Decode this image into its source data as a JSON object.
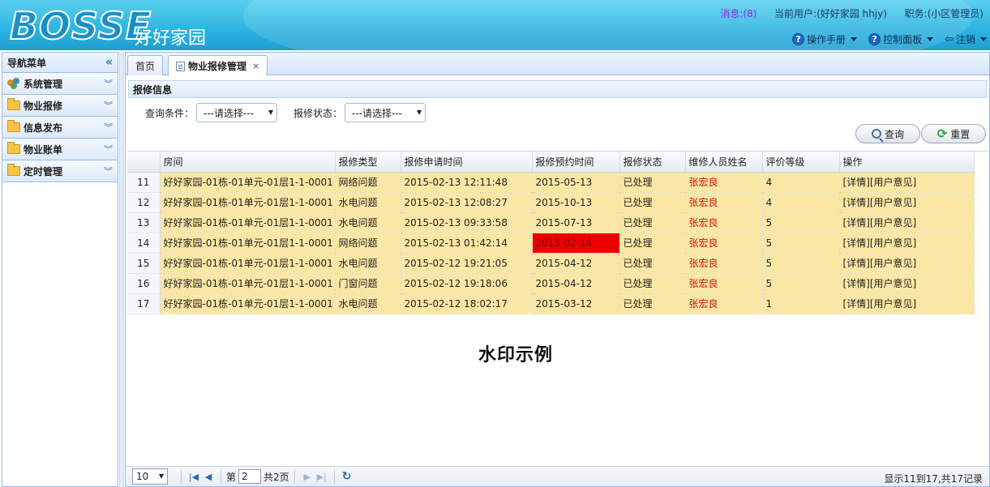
{
  "header": {
    "logo": "BOSSE",
    "site_name": "好好家园",
    "messages_label": "消息:",
    "messages_count": "(8)",
    "current_user": "当前用户:(好好家园 hhjy)",
    "position": "职务:(小区管理员)",
    "menu": {
      "manual": "操作手册",
      "control_panel": "控制面板",
      "logout": "注销"
    }
  },
  "sidebar": {
    "title": "导航菜单",
    "items": [
      "系统管理",
      "物业报修",
      "信息发布",
      "物业账单",
      "定时管理"
    ]
  },
  "tabs": {
    "home": "首页",
    "repair": "物业报修管理"
  },
  "panel": {
    "title": "报修信息",
    "filter_condition_label": "查询条件：",
    "filter_condition_value": "---请选择---",
    "filter_status_label": "报修状态：",
    "filter_status_value": "---请选择---",
    "search_button": "查询",
    "reset_button": "重置"
  },
  "table": {
    "columns": [
      "房间",
      "报修类型",
      "报修申请时间",
      "报修预约时间",
      "报修状态",
      "维修人员姓名",
      "评价等级",
      "操作"
    ],
    "rows": [
      [
        "11",
        "好好家园-01栋-01单元-01层1-1-0001",
        "网络问题",
        "2015-02-13 12:11:48",
        "2015-05-13",
        "已处理",
        "张宏良",
        "4",
        "[详情][用户意见]"
      ],
      [
        "12",
        "好好家园-01栋-01单元-01层1-1-0001",
        "水电问题",
        "2015-02-13 12:08:27",
        "2015-10-13",
        "已处理",
        "张宏良",
        "4",
        "[详情][用户意见]"
      ],
      [
        "13",
        "好好家园-01栋-01单元-01层1-1-0001",
        "水电问题",
        "2015-02-13 09:33:58",
        "2015-07-13",
        "已处理",
        "张宏良",
        "5",
        "[详情][用户意见]"
      ],
      [
        "14",
        "好好家园-01栋-01单元-01层1-1-0001",
        "网络问题",
        "2015-02-13 01:42:14",
        "2015-02-14",
        "已处理",
        "张宏良",
        "5",
        "[详情][用户意见]"
      ],
      [
        "15",
        "好好家园-01栋-01单元-01层1-1-0001",
        "水电问题",
        "2015-02-12 19:21:05",
        "2015-04-12",
        "已处理",
        "张宏良",
        "5",
        "[详情][用户意见]"
      ],
      [
        "16",
        "好好家园-01栋-01单元-01层1-1-0001",
        "门窗问题",
        "2015-02-12 19:18:06",
        "2015-04-12",
        "已处理",
        "张宏良",
        "5",
        "[详情][用户意见]"
      ],
      [
        "17",
        "好好家园-01栋-01单元-01层1-1-0001",
        "水电问题",
        "2015-02-12 18:02:17",
        "2015-03-12",
        "已处理",
        "张宏良",
        "1",
        "[详情][用户意见]"
      ]
    ],
    "watermark": "水印示例"
  },
  "pager": {
    "page_size": "10",
    "page_prefix": "第",
    "current_page": "2",
    "total_pages": "共2页",
    "info": "显示11到17,共17记录"
  },
  "colors": {
    "header_blue": "#2fb6e2",
    "row_highlight": "#fbe7a5",
    "repair_name": "#d21010",
    "alert_cell": "#ee0000"
  }
}
